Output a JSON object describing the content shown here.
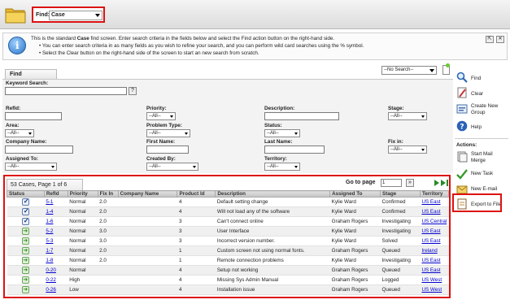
{
  "topbar": {
    "find_label": "Find:",
    "find_value": "Case"
  },
  "info": {
    "line1_pre": "This is the standard ",
    "line1_bold": "Case",
    "line1_post": " find screen. Enter search criteria in the fields below and select the Find action button on the right-hand side.",
    "line2": "•  You can enter search criteria in as many fields as you wish to refine your search, and you can perform wild card searches using the % symbol.",
    "line3": "•  Select the Clear button on the right-hand side of the screen to start an new search from scratch."
  },
  "form": {
    "tab_label": "Find",
    "saved_search": "--No Search--",
    "keyword_label": "Keyword Search:",
    "keyword_help": "?",
    "refid_label": "RefId:",
    "priority_label": "Priority:",
    "priority_value": "--All--",
    "description_label": "Description:",
    "stage_label": "Stage:",
    "stage_value": "--All--",
    "area_label": "Area:",
    "area_value": "--All--",
    "problem_type_label": "Problem Type:",
    "problem_type_value": "--All--",
    "status_label": "Status:",
    "status_value": "--All--",
    "company_name_label": "Company Name:",
    "first_name_label": "First Name:",
    "last_name_label": "Last Name:",
    "fix_in_label": "Fix in:",
    "fix_in_value": "--All--",
    "assigned_to_label": "Assigned To:",
    "assigned_to_value": "--All--",
    "created_by_label": "Created By:",
    "created_by_value": "--All--",
    "territory_label": "Territory:",
    "territory_value": "--All--"
  },
  "sidebar": {
    "find": "Find",
    "clear": "Clear",
    "create_group_1": "Create New",
    "create_group_2": "Group",
    "help": "Help",
    "actions_title": "Actions:",
    "start_mail_1": "Start Mail",
    "start_mail_2": "Merge",
    "new_task": "New Task",
    "new_email": "New E-mail",
    "export": "Export to File"
  },
  "results": {
    "summary": "53 Cases, Page 1 of 6",
    "goto_label": "Go to page",
    "goto_value": "1",
    "goto_button": "»",
    "columns": [
      "Status",
      "RefId",
      "Priority",
      "Fix In",
      "Company Name",
      "Product Id",
      "Description",
      "Assigned To",
      "Stage",
      "Territory"
    ],
    "rows": [
      {
        "status": "check",
        "refid": "5-1",
        "priority": "Normal",
        "fix_in": "2.0",
        "company": "",
        "product": "4",
        "description": "Default setting change",
        "assigned": "Kylie Ward",
        "stage": "Confirmed",
        "territory": "US East"
      },
      {
        "status": "check",
        "refid": "1-4",
        "priority": "Normal",
        "fix_in": "2.0",
        "company": "",
        "product": "4",
        "description": "Will not load any of the software",
        "assigned": "Kylie Ward",
        "stage": "Confirmed",
        "territory": "US East"
      },
      {
        "status": "check",
        "refid": "1-6",
        "priority": "Normal",
        "fix_in": "2.0",
        "company": "",
        "product": "3",
        "description": "Can't connect online",
        "assigned": "Graham Rogers",
        "stage": "Investigating",
        "territory": "US Central"
      },
      {
        "status": "arrow",
        "refid": "5-2",
        "priority": "Normal",
        "fix_in": "3.0",
        "company": "",
        "product": "3",
        "description": "User Interface",
        "assigned": "Kylie Ward",
        "stage": "Investigating",
        "territory": "US East"
      },
      {
        "status": "arrow",
        "refid": "5-3",
        "priority": "Normal",
        "fix_in": "3.0",
        "company": "",
        "product": "3",
        "description": "Incorrect version number.",
        "assigned": "Kylie Ward",
        "stage": "Solved",
        "territory": "US East"
      },
      {
        "status": "arrow",
        "refid": "1-7",
        "priority": "Normal",
        "fix_in": "2.0",
        "company": "",
        "product": "1",
        "description": "Custom screen not using normal fonts.",
        "assigned": "Graham Rogers",
        "stage": "Queued",
        "territory": "Ireland"
      },
      {
        "status": "arrow",
        "refid": "1-8",
        "priority": "Normal",
        "fix_in": "2.0",
        "company": "",
        "product": "1",
        "description": "Remote connection problems",
        "assigned": "Kylie Ward",
        "stage": "Investigating",
        "territory": "US East"
      },
      {
        "status": "arrow",
        "refid": "0-20",
        "priority": "Normal",
        "fix_in": "",
        "company": "",
        "product": "4",
        "description": "Setup not working",
        "assigned": "Graham Rogers",
        "stage": "Queued",
        "territory": "US East"
      },
      {
        "status": "arrow",
        "refid": "0-22",
        "priority": "High",
        "fix_in": "",
        "company": "",
        "product": "4",
        "description": "Missing Sys Admin Manual",
        "assigned": "Graham Rogers",
        "stage": "Logged",
        "territory": "US West"
      },
      {
        "status": "arrow",
        "refid": "0-26",
        "priority": "Low",
        "fix_in": "",
        "company": "",
        "product": "4",
        "description": "Installation issue",
        "assigned": "Graham Rogers",
        "stage": "Queued",
        "territory": "US West"
      }
    ]
  }
}
